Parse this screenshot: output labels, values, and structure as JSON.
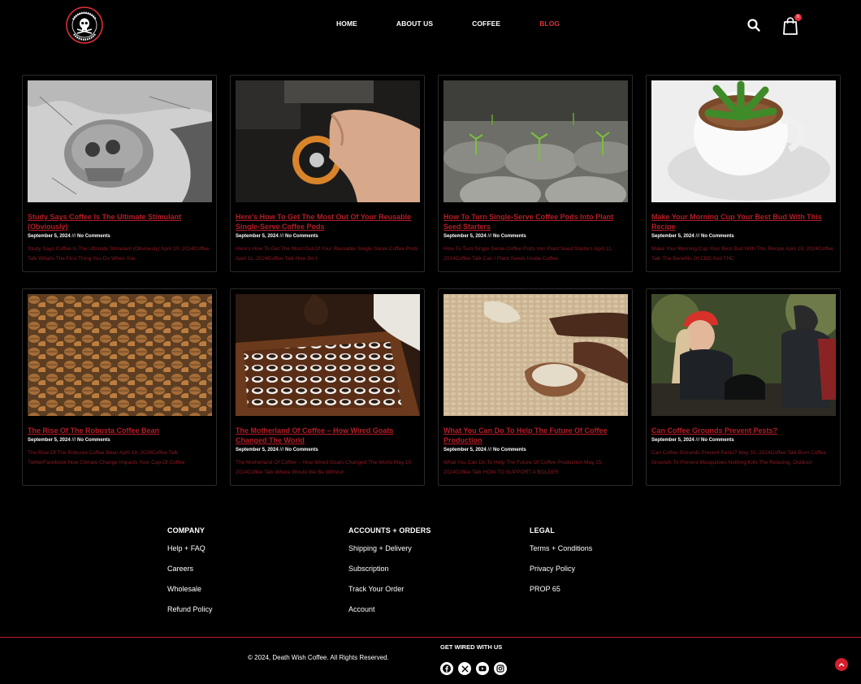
{
  "brand": {
    "name": "DEATH WISH COFFEE CO",
    "accent": "#e0303a"
  },
  "nav": {
    "items": [
      {
        "label": "HOME"
      },
      {
        "label": "ABOUT US"
      },
      {
        "label": "COFFEE"
      },
      {
        "label": "BLOG",
        "active": true
      }
    ],
    "search_icon": "search-icon",
    "cart": {
      "icon": "cart-icon",
      "count": "0"
    }
  },
  "posts": [
    {
      "title": "Study Says Coffee Is The Ultimate Stimulant (Obviously)",
      "date": "September 5, 2024",
      "comments": "No Comments",
      "excerpt": "Study Says Coffee Is The Ultimate Stimulant (Obviously) April 10, 2024Coffee Talk What's The First Thing You Do When You"
    },
    {
      "title": "Here's How To Get The Most Out Of Your Reusable Single-Serve Coffee Pods",
      "date": "September 5, 2024",
      "comments": "No Comments",
      "excerpt": "Here's How To Get The Most Out Of Your Reusable Single-Serve Coffee Pods April 11, 2024Coffee Talk How Do I"
    },
    {
      "title": "How To Turn Single-Serve Coffee Pods Into Plant Seed Starters",
      "date": "September 5, 2024",
      "comments": "No Comments",
      "excerpt": "How To Turn Single-Serve Coffee Pods Into Plant Seed Starters April 11, 2024Coffee Talk Can I Plant Seeds Inside Coffee"
    },
    {
      "title": "Make Your Morning Cup Your Best Bud With This Recipe",
      "date": "September 5, 2024",
      "comments": "No Comments",
      "excerpt": "Make Your Morning Cup Your Best Bud With This Recipe April 18, 2024Coffee Talk The Benefits Of CBD And THC"
    },
    {
      "title": "The Rise Of The Robusta Coffee Bean",
      "date": "September 5, 2024",
      "comments": "No Comments",
      "excerpt": "The Rise Of The Robusta Coffee Bean April 18, 2024Coffee Talk TwitterFacebook How Climate Change Impacts Your Cup Of Coffee"
    },
    {
      "title": "The Motherland Of Coffee – How Wired Goats Changed The World",
      "date": "September 5, 2024",
      "comments": "No Comments",
      "excerpt": "The Motherland Of Coffee – How Wired Goats Changed The World May 10, 2024Coffee Talk Where Would We Be Without"
    },
    {
      "title": "What You Can Do To Help The Future Of Coffee Production",
      "date": "September 5, 2024",
      "comments": "No Comments",
      "excerpt": "What You Can Do To Help The Future Of Coffee Production May 15, 2024Coffee Talk HOW TO SUPPORT A BOLDER"
    },
    {
      "title": "Can Coffee Grounds Prevent Pests?",
      "date": "September 5, 2024",
      "comments": "No Comments",
      "excerpt": "Can Coffee Grounds Prevent Pests? May 31, 2024Coffee Talk Burn Coffee Grounds To Prevent Mosquitoes Nothing Kills The Relaxing, Outdoor"
    }
  ],
  "meta_separator": " /// ",
  "footer": {
    "columns": [
      {
        "heading": "COMPANY",
        "links": [
          "Help + FAQ",
          "Careers",
          "Wholesale",
          "Refund Policy"
        ]
      },
      {
        "heading": "ACCOUNTS + ORDERS",
        "links": [
          "Shipping + Delivery",
          "Subscription",
          "Track Your Order",
          "Account"
        ]
      },
      {
        "heading": "LEGAL",
        "links": [
          "Terms + Conditions",
          "Privacy Policy",
          "PROP 65"
        ]
      }
    ],
    "copyright": "© 2024, Death Wish Coffee. All Rights Reserved.",
    "social_heading": "GET WIRED WITH US",
    "socials": [
      "facebook-icon",
      "x-icon",
      "youtube-icon",
      "instagram-icon"
    ],
    "back_to_top_icon": "chevron-up-icon"
  }
}
